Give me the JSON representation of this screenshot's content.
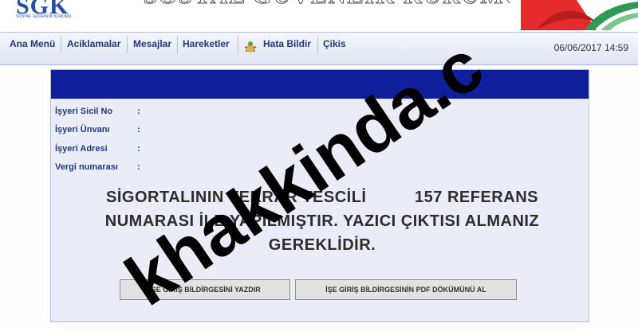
{
  "header": {
    "logo_text": "SGK",
    "logo_subtext": "SOSYAL GÜVENLİK KURUMU",
    "banner_title": "SOSYAL GÜVENLİK KURUMU"
  },
  "menu": {
    "items": [
      "Ana Menü",
      "Aciklamalar",
      "Mesajlar",
      "Hareketler",
      "Hata Bildir",
      "Çikis"
    ],
    "datetime": "06/06/2017 14:59"
  },
  "form": {
    "fields": [
      {
        "label": "İşyeri Sicil No",
        "value": ""
      },
      {
        "label": "İşyeri Ünvanı",
        "value": ""
      },
      {
        "label": "İşyeri Adresi",
        "value": ""
      },
      {
        "label": "Vergi numarası",
        "value": ""
      }
    ],
    "colon": ":"
  },
  "message": {
    "line1": "SİGORTALININ TEKRAR TESCİLİ          157 REFERANS",
    "line2": "NUMARASI İLE YAPILMIŞTIR. YAZICI ÇIKTISI ALMANIZ",
    "line3": "GEREKLİDİR."
  },
  "buttons": {
    "print": "İŞE GİRİŞ BİLDİRGESİNİ YAZDIR",
    "pdf": "İŞE GİRİŞ BİLDİRGESİNİN PDF DÖKÜMÜNÜ AL"
  },
  "watermark": "khakkinda.c",
  "colors": {
    "panel_header": "#0f1e9a",
    "menu_text": "#1f3a78",
    "panel_bg": "#eaedf8",
    "brand_red": "#e52a2a",
    "brand_green": "#2e9a57"
  }
}
